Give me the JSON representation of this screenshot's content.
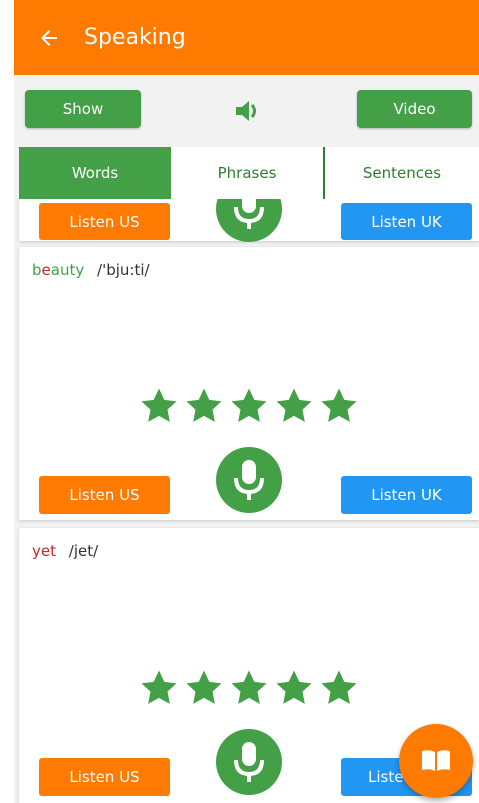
{
  "appbar": {
    "title": "Speaking",
    "back_icon": "arrow-left-icon",
    "color": "#ff7a00"
  },
  "toolbar": {
    "show_label": "Show",
    "video_label": "Video",
    "speaker_icon": "speaker-icon"
  },
  "tabs": [
    {
      "label": "Words",
      "active": true
    },
    {
      "label": "Phrases",
      "active": false
    },
    {
      "label": "Sentences",
      "active": false
    }
  ],
  "cards": [
    {
      "word": "",
      "ipa": "",
      "stars": 0,
      "listen_us": "Listen US",
      "listen_uk": "Listen UK"
    },
    {
      "word_parts": [
        "b",
        "e",
        "a",
        "uty"
      ],
      "ipa": "/'bju:ti/",
      "stars": 5,
      "listen_us": "Listen US",
      "listen_uk": "Listen UK"
    },
    {
      "word": "yet",
      "ipa": "/jet/",
      "stars": 5,
      "listen_us": "Listen US",
      "listen_uk": "Liste"
    }
  ],
  "fab": {
    "icon": "book-icon"
  },
  "colors": {
    "green": "#43a047",
    "orange": "#ff7a00",
    "blue": "#2196f3"
  }
}
